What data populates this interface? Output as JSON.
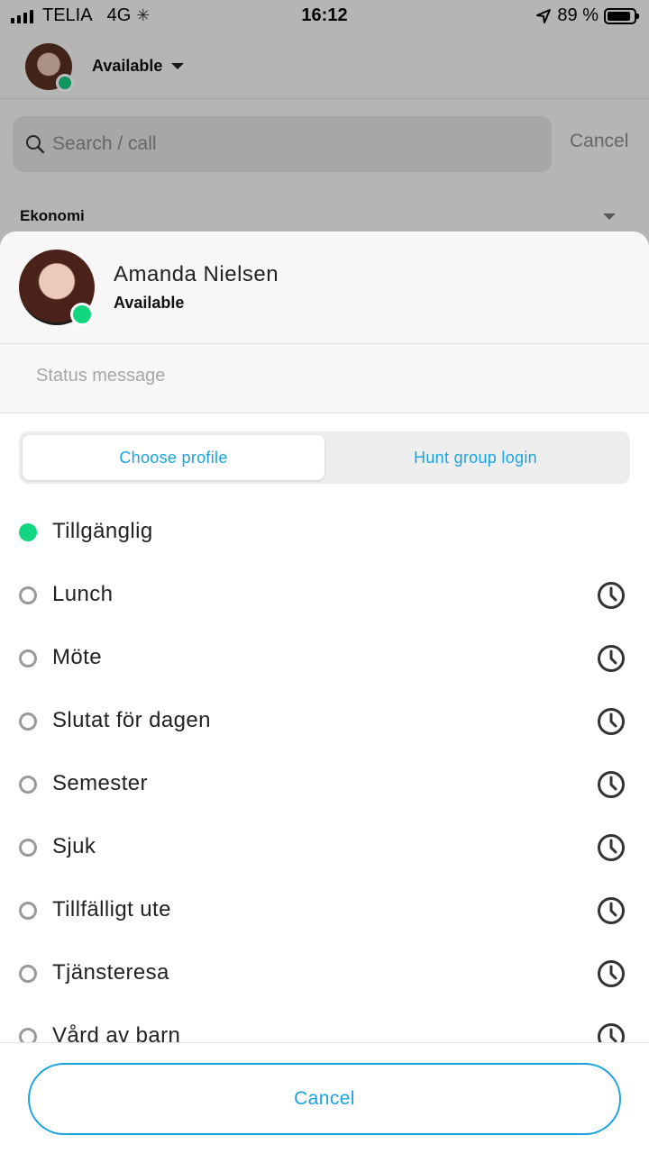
{
  "status_bar": {
    "carrier": "TELIA",
    "network": "4G",
    "time": "16:12",
    "battery": "89 %"
  },
  "header": {
    "status": "Available"
  },
  "search": {
    "placeholder": "Search / call",
    "cancel_label": "Cancel"
  },
  "section": {
    "label": "Ekonomi"
  },
  "sheet": {
    "user_name": "Amanda Nielsen",
    "user_status": "Available",
    "status_message_placeholder": "Status message",
    "tabs": [
      {
        "label": "Choose profile",
        "active": true
      },
      {
        "label": "Hunt group login",
        "active": false
      }
    ],
    "options": [
      {
        "label": "Tillgänglig",
        "selected": true
      },
      {
        "label": "Lunch",
        "selected": false
      },
      {
        "label": "Möte",
        "selected": false
      },
      {
        "label": "Slutat för dagen",
        "selected": false
      },
      {
        "label": "Semester",
        "selected": false
      },
      {
        "label": "Sjuk",
        "selected": false
      },
      {
        "label": "Tillfälligt ute",
        "selected": false
      },
      {
        "label": "Tjänsteresa",
        "selected": false
      },
      {
        "label": "Vård av barn",
        "selected": false
      }
    ],
    "cancel_label": "Cancel"
  },
  "colors": {
    "accent": "#1aa3e0",
    "available": "#11d67f"
  }
}
